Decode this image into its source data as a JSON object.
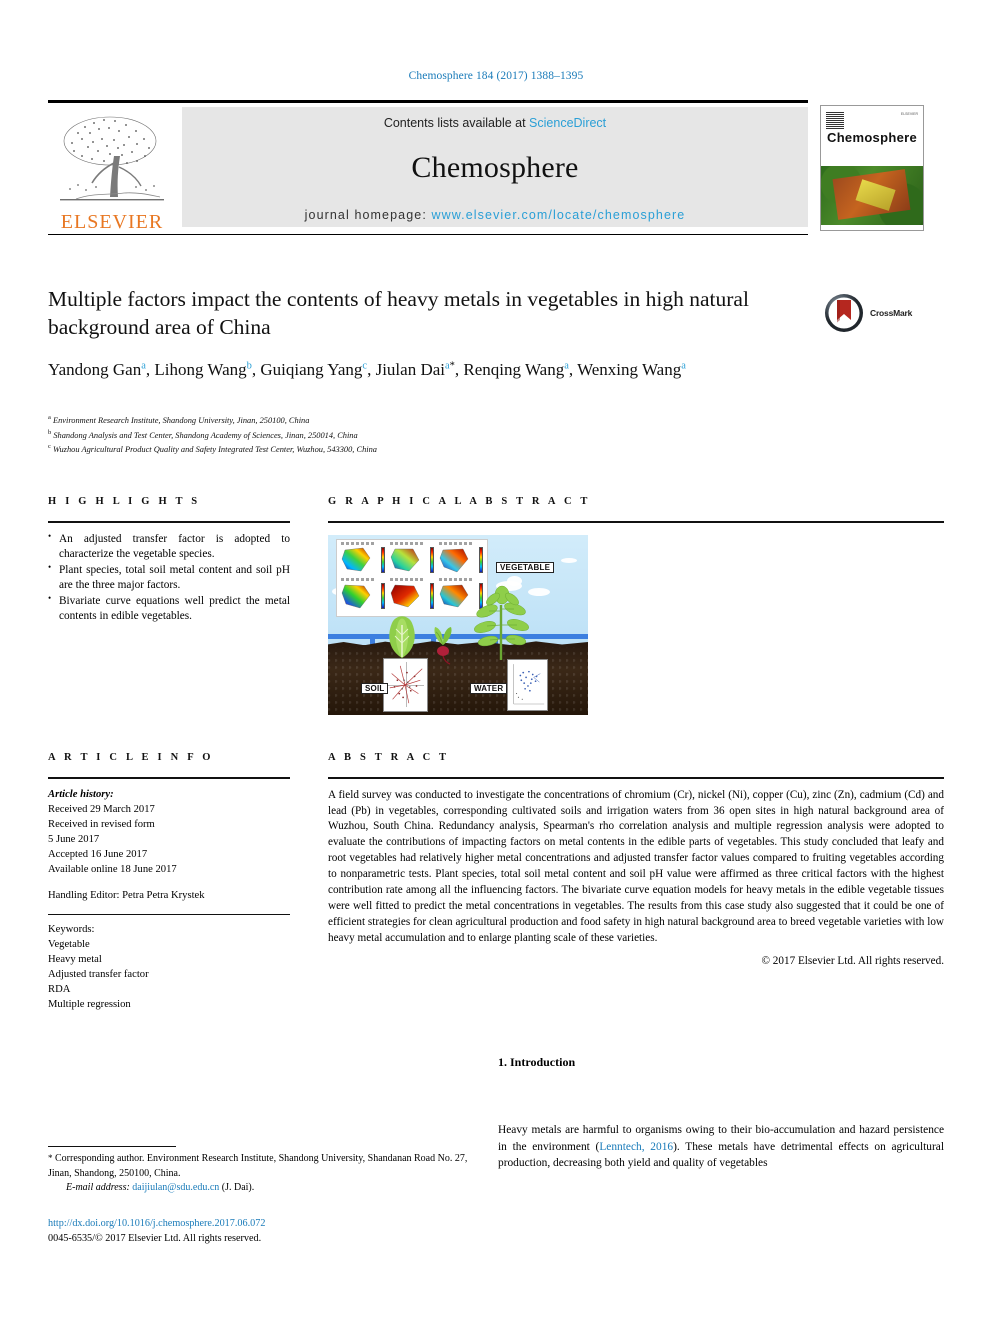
{
  "running_head": "Chemosphere 184 (2017) 1388–1395",
  "header": {
    "contents_prefix": "Contents lists available at ",
    "contents_link": "ScienceDirect",
    "journal_title": "Chemosphere",
    "homepage_prefix": "journal homepage: ",
    "homepage_url": "www.elsevier.com/locate/chemosphere",
    "publisher_logo_text": "ELSEVIER",
    "cover_title": "Chemosphere",
    "cover_corner_tag": "ELSEVIER"
  },
  "article": {
    "title": "Multiple factors impact the contents of heavy metals in vegetables in high natural background area of China",
    "crossmark_label": "CrossMark",
    "authors": [
      {
        "name": "Yandong Gan",
        "marks": "a",
        "sep": ", "
      },
      {
        "name": "Lihong Wang",
        "marks": "b",
        "sep": ", "
      },
      {
        "name": "Guiqiang Yang",
        "marks": "c",
        "sep": ", "
      },
      {
        "name": "Jiulan Dai",
        "marks": "a",
        "star": "*",
        "sep": ", "
      },
      {
        "name": "Renqing Wang",
        "marks": "a",
        "sep": ", "
      },
      {
        "name": "Wenxing Wang",
        "marks": "a",
        "sep": ""
      }
    ],
    "affiliations": [
      {
        "mark": "a",
        "text": "Environment Research Institute, Shandong University, Jinan, 250100, China"
      },
      {
        "mark": "b",
        "text": "Shandong Analysis and Test Center, Shandong Academy of Sciences, Jinan, 250014, China"
      },
      {
        "mark": "c",
        "text": "Wuzhou Agricultural Product Quality and Safety Integrated Test Center, Wuzhou, 543300, China"
      }
    ]
  },
  "highlights": {
    "heading": "H I G H L I G H T S",
    "items": [
      "An adjusted transfer factor is adopted to characterize the vegetable species.",
      "Plant species, total soil metal content and soil pH are the three major factors.",
      "Bivariate curve equations well predict the metal contents in edible vegetables."
    ]
  },
  "graphical_abstract": {
    "heading": "G R A P H I C A L  A B S T R A C T",
    "labels": {
      "vegetable": "VEGETABLE",
      "soil": "SOIL",
      "water": "WATER"
    }
  },
  "article_info": {
    "heading": "A R T I C L E  I N F O",
    "history_label": "Article history:",
    "history": [
      "Received 29 March 2017",
      "Received in revised form",
      "5 June 2017",
      "Accepted 16 June 2017",
      "Available online 18 June 2017"
    ],
    "handling_editor": "Handling Editor: Petra Petra Krystek",
    "keywords_label": "Keywords:",
    "keywords": [
      "Vegetable",
      "Heavy metal",
      "Adjusted transfer factor",
      "RDA",
      "Multiple regression"
    ]
  },
  "abstract": {
    "heading": "A B S T R A C T",
    "text": "A field survey was conducted to investigate the concentrations of chromium (Cr), nickel (Ni), copper (Cu), zinc (Zn), cadmium (Cd) and lead (Pb) in vegetables, corresponding cultivated soils and irrigation waters from 36 open sites in high natural background area of Wuzhou, South China. Redundancy analysis, Spearman's rho correlation analysis and multiple regression analysis were adopted to evaluate the contributions of impacting factors on metal contents in the edible parts of vegetables. This study concluded that leafy and root vegetables had relatively higher metal concentrations and adjusted transfer factor values compared to fruiting vegetables according to nonparametric tests. Plant species, total soil metal content and soil pH value were affirmed as three critical factors with the highest contribution rate among all the influencing factors. The bivariate curve equation models for heavy metals in the edible vegetable tissues were well fitted to predict the metal concentrations in vegetables. The results from this case study also suggested that it could be one of efficient strategies for clean agricultural production and food safety in high natural background area to breed vegetable varieties with low heavy metal accumulation and to enlarge planting scale of these varieties.",
    "copyright": "© 2017 Elsevier Ltd. All rights reserved."
  },
  "introduction": {
    "heading": "1. Introduction",
    "paragraph_pre": "Heavy metals are harmful to organisms owing to their bio-accumulation and hazard persistence in the environment (",
    "citation": "Lenntech, 2016",
    "paragraph_post": "). These metals have detrimental effects on agricultural production, decreasing both yield and quality of vegetables"
  },
  "footer": {
    "corresponding_marker": "*",
    "corresponding_text": " Corresponding author. Environment Research Institute, Shandong University, Shandanan Road No. 27, Jinan, Shandong, 250100, China.",
    "email_label": "E-mail address:",
    "email": "daijiulan@sdu.edu.cn",
    "email_suffix": "(J. Dai).",
    "doi": "http://dx.doi.org/10.1016/j.chemosphere.2017.06.072",
    "issn_line": "0045-6535/© 2017 Elsevier Ltd. All rights reserved."
  },
  "colors": {
    "link_blue": "#1a7bb9",
    "sciencedirect_blue": "#2a9fd6",
    "elsevier_orange": "#E87722",
    "banner_gray": "#e6e6e6"
  }
}
